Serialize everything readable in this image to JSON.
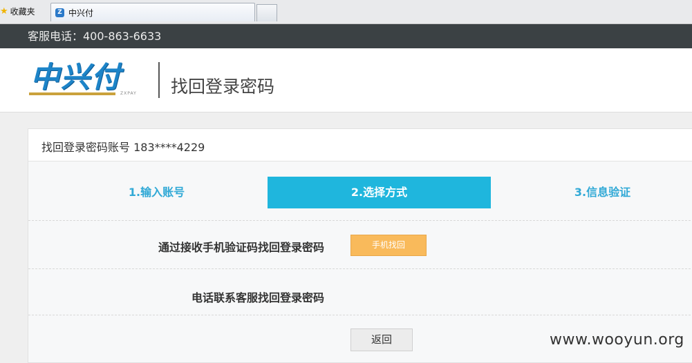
{
  "browser": {
    "favorites_label": "收藏夹",
    "tab_title": "中兴付",
    "tab_icon_glyph": "Z"
  },
  "service": {
    "phone_text": "客服电话：400-863-6633"
  },
  "header": {
    "logo_text": "中兴付",
    "logo_subtext": "ZXPAY",
    "page_title": "找回登录密码"
  },
  "account": {
    "label": "找回登录密码账号 183****4229"
  },
  "steps": [
    {
      "label": "1.输入账号",
      "active": false
    },
    {
      "label": "2.选择方式",
      "active": true
    },
    {
      "label": "3.信息验证",
      "active": false
    }
  ],
  "options": {
    "sms_label": "通过接收手机验证码找回登录密码",
    "sms_button": "手机找回",
    "service_label": "电话联系客服找回登录密码"
  },
  "actions": {
    "back_label": "返回"
  },
  "watermark": "www.wooyun.org",
  "colors": {
    "topbar": "#3b4144",
    "brand_blue": "#1d84c8",
    "step_active_bg": "#1fb6dd",
    "step_text": "#31a9d6",
    "phone_button_bg": "#f9ba5b"
  }
}
